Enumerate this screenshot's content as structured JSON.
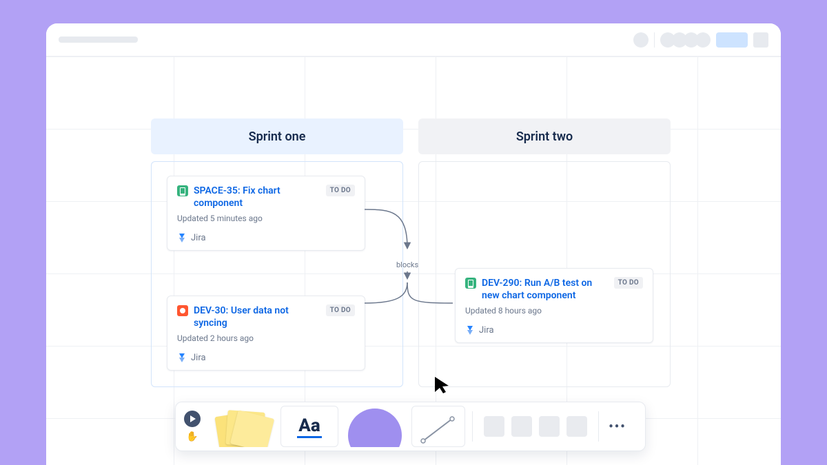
{
  "sprints": {
    "one": {
      "title": "Sprint one"
    },
    "two": {
      "title": "Sprint two"
    }
  },
  "connector": {
    "label": "blocks"
  },
  "cards": {
    "space35": {
      "title": "SPACE-35: Fix chart component",
      "status": "TO DO",
      "updated": "Updated 5 minutes ago",
      "source": "Jira"
    },
    "dev30": {
      "title": "DEV-30: User data not syncing",
      "status": "TO DO",
      "updated": "Updated 2 hours ago",
      "source": "Jira"
    },
    "dev290": {
      "title": "DEV-290: Run A/B test on new chart component",
      "status": "TO DO",
      "updated": "Updated 8 hours ago",
      "source": "Jira"
    }
  },
  "toolbar": {
    "text_label": "Aa",
    "more": "•••"
  }
}
